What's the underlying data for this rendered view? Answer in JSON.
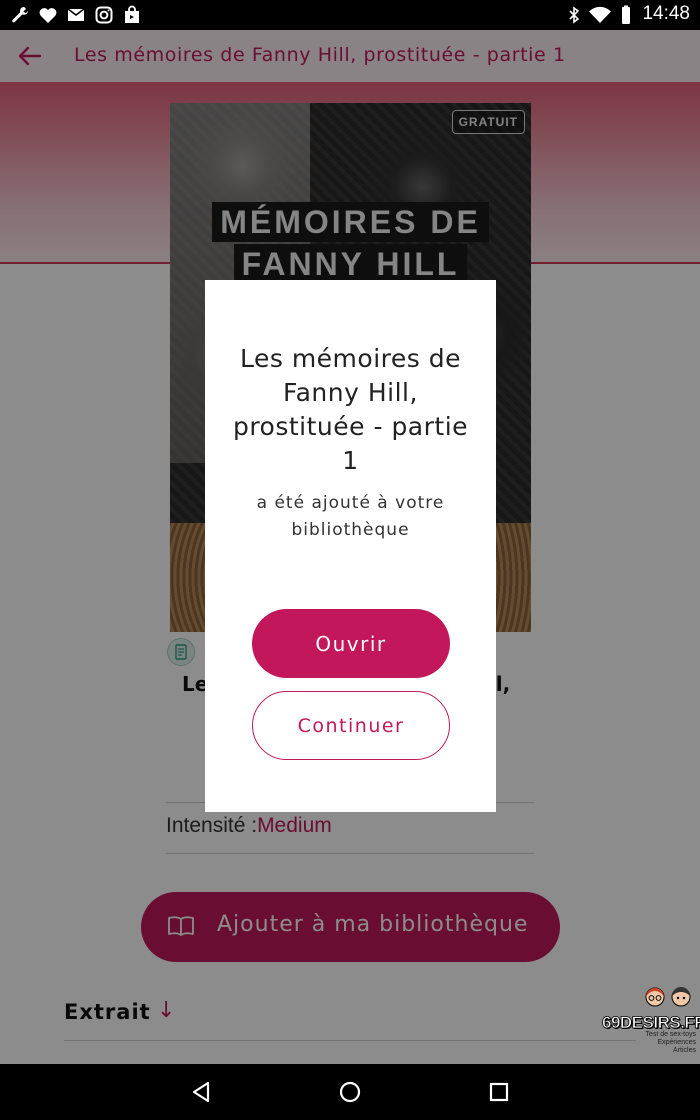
{
  "status_bar": {
    "time": "14:48",
    "left_icons": [
      "wrench-icon",
      "heart-icon",
      "mail-icon",
      "instagram-icon",
      "shopping-bag-icon"
    ],
    "right_icons": [
      "bluetooth-icon",
      "wifi-icon",
      "battery-icon"
    ]
  },
  "app_bar": {
    "title": "Les mémoires de Fanny Hill, prostituée - partie 1"
  },
  "book": {
    "cover_badge": "GRATUIT",
    "cover_title_line1": "MÉMOIRES DE",
    "cover_title_line2": "FANNY HILL",
    "title_visible_left": "Le",
    "title_visible_right": "ill,",
    "intensity_label": "Intensité :",
    "intensity_value": "Medium",
    "add_button_label": "Ajouter à ma bibliothèque",
    "excerpt_label": "Extrait"
  },
  "dialog": {
    "title": "Les mémoires de Fanny Hill, prostituée - partie 1",
    "message": "a été ajouté à votre bibliothèque",
    "open_label": "Ouvrir",
    "continue_label": "Continuer"
  },
  "watermark": {
    "text": "69DESIRS.FR",
    "sub_line1": "Test de sex-toys",
    "sub_line2": "Expériences",
    "sub_line3": "Articles"
  },
  "colors": {
    "accent": "#c2185b",
    "header_band": "#e4607a",
    "overlay": "rgba(0,0,0,0.45)"
  }
}
